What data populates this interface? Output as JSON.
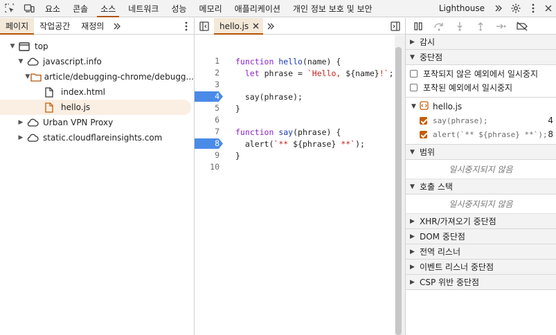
{
  "topbar": {
    "tabs": [
      "요소",
      "콘솔",
      "소스",
      "네트워크",
      "성능",
      "메모리",
      "애플리케이션",
      "개인 정보 보호 및 보안",
      "Lighthouse"
    ],
    "active_tab": "소스"
  },
  "left": {
    "tabs": [
      "페이지",
      "작업공간",
      "재정의"
    ],
    "tree": {
      "top": "top",
      "origin": "javascript.info",
      "folder": "article/debugging-chrome/debugg...",
      "file1": "index.html",
      "file2": "hello.js",
      "other1": "Urban VPN Proxy",
      "other2": "static.cloudflareinsights.com"
    }
  },
  "editor": {
    "file_tab": "hello.js",
    "lines": [
      {
        "n": "1",
        "tokens": [
          [
            "kw",
            "function "
          ],
          [
            "fn",
            "hello"
          ],
          [
            "",
            "(name) {"
          ]
        ]
      },
      {
        "n": "2",
        "tokens": [
          [
            "",
            "  "
          ],
          [
            "kw",
            "let "
          ],
          [
            "",
            "phrase = "
          ],
          [
            "str",
            "`Hello, "
          ],
          [
            "",
            "${name}"
          ],
          [
            "str",
            "!`"
          ],
          [
            "",
            ";"
          ]
        ]
      },
      {
        "n": "3",
        "tokens": [
          [
            "",
            ""
          ]
        ]
      },
      {
        "n": "4",
        "tokens": [
          [
            "",
            "  say(phrase);"
          ]
        ],
        "bp": true
      },
      {
        "n": "5",
        "tokens": [
          [
            "",
            "}"
          ]
        ]
      },
      {
        "n": "6",
        "tokens": [
          [
            "",
            ""
          ]
        ]
      },
      {
        "n": "7",
        "tokens": [
          [
            "kw",
            "function "
          ],
          [
            "fn",
            "say"
          ],
          [
            "",
            "(phrase) {"
          ]
        ]
      },
      {
        "n": "8",
        "tokens": [
          [
            "",
            "  alert("
          ],
          [
            "str",
            "`** "
          ],
          [
            "",
            "${phrase}"
          ],
          [
            "str",
            " **`"
          ],
          [
            "",
            ");"
          ]
        ],
        "bp": true
      },
      {
        "n": "9",
        "tokens": [
          [
            "",
            "}"
          ]
        ]
      },
      {
        "n": "10",
        "tokens": [
          [
            "",
            ""
          ]
        ]
      }
    ]
  },
  "right": {
    "watch": "감시",
    "breakpoints": "중단점",
    "pause_uncaught": "포착되지 않은 예외에서 일시중지",
    "pause_caught": "포착된 예외에서 일시중지",
    "bp_file": "hello.js",
    "bp1_code": "say(phrase);",
    "bp1_line": "4",
    "bp2_code": "alert(`** ${phrase} **`);",
    "bp2_line": "8",
    "scope": "범위",
    "not_paused": "일시중지되지 않음",
    "call_stack": "호출 스택",
    "xhr": "XHR/가져오기 중단점",
    "dom": "DOM 중단점",
    "global": "전역 리스너",
    "event": "이벤트 리스너 중단점",
    "csp": "CSP 위반 중단점"
  }
}
